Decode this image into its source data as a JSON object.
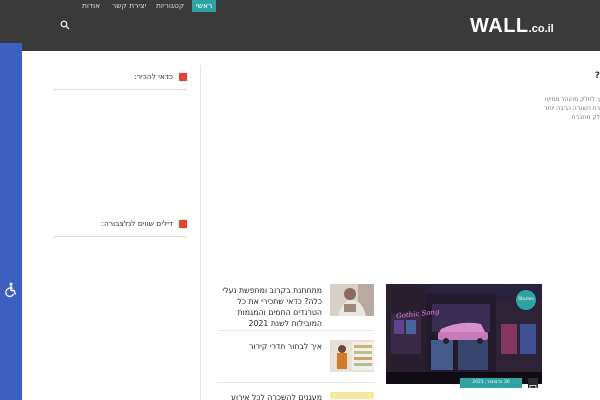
{
  "header": {
    "logo_main": "WALL",
    "logo_sub": ".co.il",
    "nav": [
      {
        "label": "ראשי",
        "active": true
      },
      {
        "label": "קטגוריות",
        "active": false
      },
      {
        "label": "יצירת קשר",
        "active": false
      },
      {
        "label": "אודות",
        "active": false
      }
    ],
    "search_icon": "search-icon"
  },
  "accessibility": {
    "icon": "wheelchair-icon",
    "bar_color": "#3c5fc0"
  },
  "hero_fragment": {
    "question_mark": "?",
    "lines": [
      "ך לזולק מהוהד מחיינו",
      "רת השגרה הרבה יותר",
      "לק מחברת"
    ]
  },
  "sidebar": {
    "widget_1_title": "כדאי להכיר:",
    "widget_2_title": "דילים שווים לנלצבורה:"
  },
  "featured": {
    "badge": "Stories",
    "date_label": "30 בדצמבר, 2021",
    "image_icon": "image-icon",
    "sign_text": "Gothic Song"
  },
  "posts": [
    {
      "title": "מתחתנת בקרוב ומחפשת נעלי כלה? כדאי שתכירי את כל הטרנדים החמים והמגמות המובילות לשנת 2021"
    },
    {
      "title": "איך לבחור חדרי קירור"
    },
    {
      "title": "מעגנים להשכרה לכל אירוע בכל"
    }
  ],
  "colors": {
    "header_bg": "#3a3a3a",
    "accent": "#2fa3a4",
    "widget_marker": "#e8422e"
  }
}
